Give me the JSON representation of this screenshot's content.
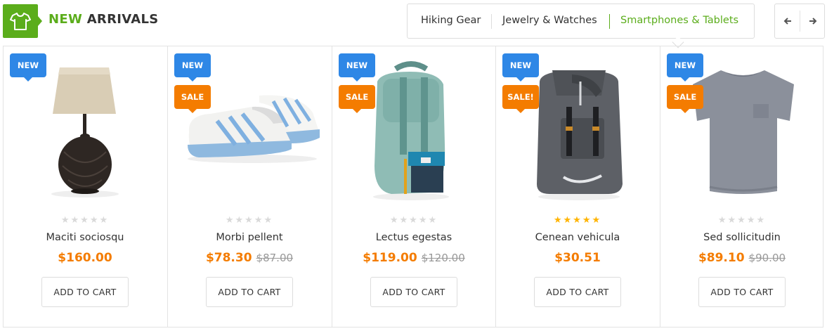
{
  "section": {
    "title_accent": "NEW",
    "title_rest": "ARRIVALS",
    "icon": "tshirt-icon"
  },
  "tabs": [
    {
      "label": "Hiking Gear",
      "active": false
    },
    {
      "label": "Jewelry & Watches",
      "active": false
    },
    {
      "label": "Smartphones & Tablets",
      "active": true
    }
  ],
  "nav": {
    "prev_icon": "arrow-left-icon",
    "next_icon": "arrow-right-icon"
  },
  "colors": {
    "accent": "#5bad1b",
    "badge_new": "#2e87e6",
    "badge_sale": "#f47c00",
    "price": "#f47c00",
    "star_on": "#ffb400",
    "star_off": "#d9d9d9"
  },
  "products": [
    {
      "name": "Maciti sociosqu",
      "price": "$160.00",
      "old_price": "",
      "rating": 0,
      "badges": [
        "NEW"
      ],
      "image": "table-lamp-image",
      "button": "ADD TO CART"
    },
    {
      "name": "Morbi pellent",
      "price": "$78.30",
      "old_price": "$87.00",
      "rating": 0,
      "badges": [
        "NEW",
        "SALE"
      ],
      "image": "sneaker-image",
      "button": "ADD TO CART"
    },
    {
      "name": "Lectus egestas",
      "price": "$119.00",
      "old_price": "$120.00",
      "rating": 0,
      "badges": [
        "NEW",
        "SALE"
      ],
      "image": "teal-backpack-image",
      "button": "ADD TO CART"
    },
    {
      "name": "Cenean vehicula",
      "price": "$30.51",
      "old_price": "",
      "rating": 5,
      "badges": [
        "NEW",
        "SALE!"
      ],
      "image": "grey-backpack-image",
      "button": "ADD TO CART"
    },
    {
      "name": "Sed sollicitudin",
      "price": "$89.10",
      "old_price": "$90.00",
      "rating": 0,
      "badges": [
        "NEW",
        "SALE"
      ],
      "image": "grey-tshirt-image",
      "button": "ADD TO CART"
    }
  ]
}
